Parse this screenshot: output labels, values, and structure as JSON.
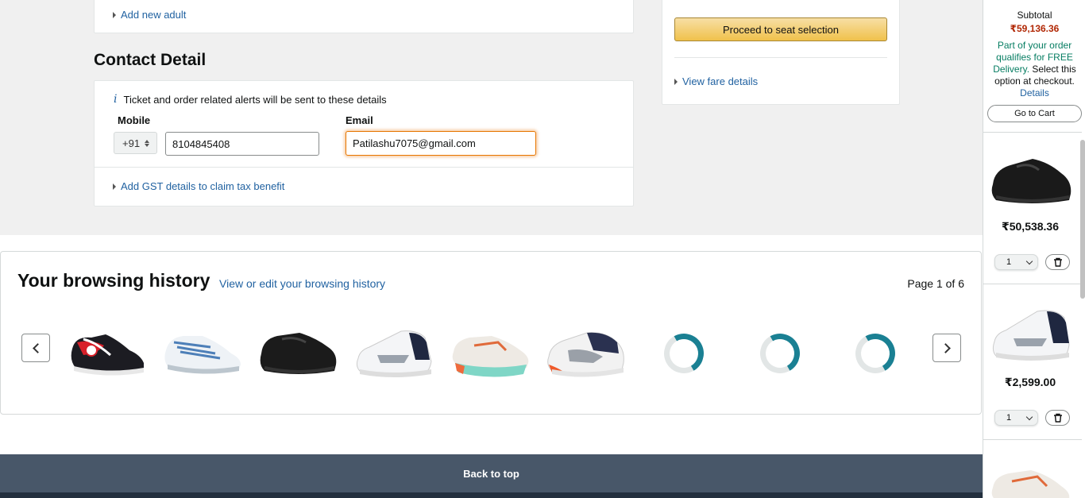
{
  "passengers": {
    "add_adult_label": "Add new adult"
  },
  "contact": {
    "title": "Contact Detail",
    "info_text": "Ticket and order related alerts will be sent to these details",
    "info_icon": "info-icon",
    "mobile_label": "Mobile",
    "country_code": "+91",
    "mobile_value": "8104845408",
    "email_label": "Email",
    "email_value": "Patilashu7075@gmail.com",
    "gst_label": "Add GST details to claim tax benefit"
  },
  "fare": {
    "proceed_label": "Proceed to seat selection",
    "view_fare_label": "View fare details"
  },
  "history": {
    "title": "Your browsing history",
    "edit_link": "View or edit your browsing history",
    "page_info": "Page 1 of 6",
    "items": [
      {
        "icon": "sneaker-black-red"
      },
      {
        "icon": "sneaker-white-blue"
      },
      {
        "icon": "sneaker-black"
      },
      {
        "icon": "sneaker-white-navy"
      },
      {
        "icon": "sneaker-white-orange-teal"
      },
      {
        "icon": "sneaker-white-navy-orange"
      }
    ],
    "loading_count_shown": 3
  },
  "footer": {
    "back_to_top": "Back to top"
  },
  "cart": {
    "subtotal_label": "Subtotal",
    "subtotal_value": "₹59,136.36",
    "delivery_green": "Part of your order qualifies for FREE Delivery.",
    "delivery_rest": " Select this option at checkout.",
    "details_link": "Details",
    "go_to_cart": "Go to Cart",
    "items": [
      {
        "price": "₹50,538.36",
        "qty": "1"
      },
      {
        "price": "₹2,599.00",
        "qty": "1"
      }
    ]
  },
  "colors": {
    "link": "#2162a1",
    "price_red": "#b12704",
    "button_yellow": "#f0c14b",
    "footer": "#485769",
    "spinner": "#1a8093"
  }
}
